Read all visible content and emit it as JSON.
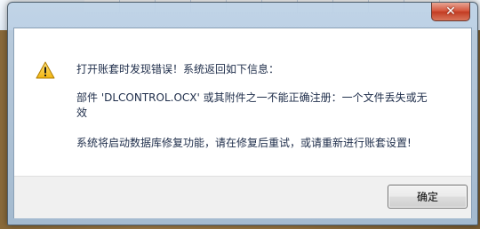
{
  "dialog": {
    "close_glyph": "✕",
    "message_line1": "打开账套时发现错误！系统返回如下信息：",
    "message_line2": "部件 'DLCONTROL.OCX' 或其附件之一不能正确注册：一个文件丢失或无效",
    "message_line3": "系统将启动数据库修复功能，请在修复后重试，或请重新进行账套设置!",
    "ok_label": "确定",
    "icon": "warning-icon"
  },
  "colors": {
    "close_red": "#c23b22",
    "warning_yellow": "#f5c21b",
    "text": "#1e2d4a"
  }
}
